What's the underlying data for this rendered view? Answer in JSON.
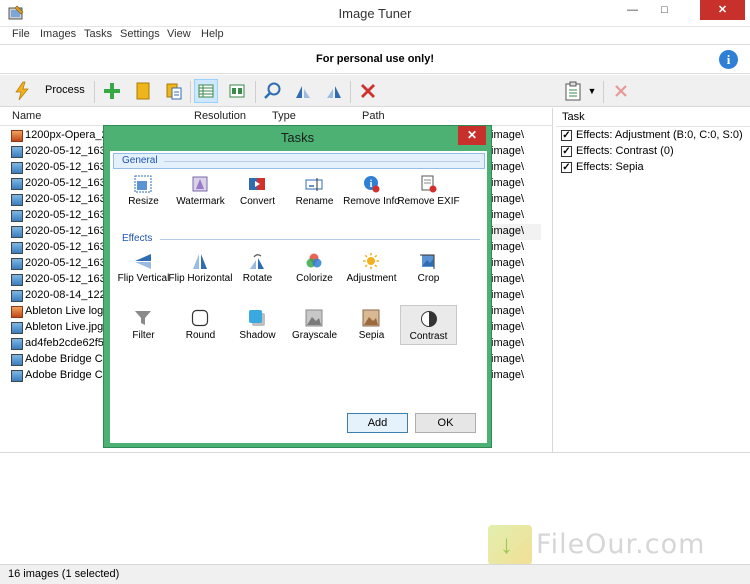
{
  "window": {
    "title": "Image Tuner",
    "min_glyph": "—",
    "max_glyph": "□",
    "close_glyph": "✕"
  },
  "menu": [
    "File",
    "Images",
    "Tasks",
    "Settings",
    "View",
    "Help"
  ],
  "notice": {
    "text": "For personal use only!",
    "info_glyph": "i"
  },
  "toolbar": {
    "process_label": "Process"
  },
  "columns": {
    "name": "Name",
    "resolution": "Resolution",
    "type": "Type",
    "path": "Path"
  },
  "files": [
    {
      "name": "1200px-Opera_2015",
      "icon": "orange-image-icon"
    },
    {
      "name": "2020-05-12_163545",
      "icon": "image-icon"
    },
    {
      "name": "2020-05-12_163630",
      "icon": "image-icon"
    },
    {
      "name": "2020-05-12_163700",
      "icon": "image-icon"
    },
    {
      "name": "2020-05-12_163720",
      "icon": "image-icon"
    },
    {
      "name": "2020-05-12_163740",
      "icon": "image-icon"
    },
    {
      "name": "2020-05-12_163810",
      "icon": "image-icon"
    },
    {
      "name": "2020-05-12_163830",
      "icon": "image-icon"
    },
    {
      "name": "2020-05-12_163850",
      "icon": "image-icon"
    },
    {
      "name": "2020-05-12_163910",
      "icon": "image-icon"
    },
    {
      "name": "2020-08-14_122520",
      "icon": "image-icon"
    },
    {
      "name": "Ableton Live logo",
      "icon": "orange-image-icon"
    },
    {
      "name": "Ableton Live.jpg",
      "icon": "image-icon"
    },
    {
      "name": "ad4feb2cde62f54f",
      "icon": "image-icon"
    },
    {
      "name": "Adobe Bridge CC",
      "icon": "image-icon"
    },
    {
      "name": "Adobe Bridge CC",
      "icon": "image-icon"
    }
  ],
  "path_values": [
    "image\\",
    "image\\",
    "image\\",
    "image\\",
    "image\\",
    "image\\",
    "image\\",
    "image\\",
    "image\\",
    "image\\",
    "image\\",
    "image\\",
    "image\\",
    "image\\",
    "image\\",
    "image\\"
  ],
  "task_panel": {
    "header": "Task",
    "items": [
      {
        "label": "Effects: Adjustment (B:0, C:0, S:0)",
        "checked": true
      },
      {
        "label": "Effects: Contrast (0)",
        "checked": true
      },
      {
        "label": "Effects: Sepia",
        "checked": true
      }
    ]
  },
  "dialog": {
    "title": "Tasks",
    "close_glyph": "✕",
    "general_label": "General",
    "effects_label": "Effects",
    "general_tiles": [
      {
        "label": "Resize",
        "icon": "resize-icon"
      },
      {
        "label": "Watermark",
        "icon": "watermark-icon"
      },
      {
        "label": "Convert",
        "icon": "convert-icon"
      },
      {
        "label": "Rename",
        "icon": "rename-icon"
      },
      {
        "label": "Remove Info",
        "icon": "remove-info-icon"
      },
      {
        "label": "Remove EXIF",
        "icon": "remove-exif-icon"
      }
    ],
    "effects_tiles_row1": [
      {
        "label": "Flip Vertical",
        "icon": "flip-vertical-icon"
      },
      {
        "label": "Flip Horizontal",
        "icon": "flip-horizontal-icon"
      },
      {
        "label": "Rotate",
        "icon": "rotate-icon"
      },
      {
        "label": "Colorize",
        "icon": "colorize-icon"
      },
      {
        "label": "Adjustment",
        "icon": "adjustment-icon"
      },
      {
        "label": "Crop",
        "icon": "crop-icon"
      }
    ],
    "effects_tiles_row2": [
      {
        "label": "Filter",
        "icon": "filter-icon"
      },
      {
        "label": "Round",
        "icon": "round-icon"
      },
      {
        "label": "Shadow",
        "icon": "shadow-icon"
      },
      {
        "label": "Grayscale",
        "icon": "grayscale-icon"
      },
      {
        "label": "Sepia",
        "icon": "sepia-icon"
      },
      {
        "label": "Contrast",
        "icon": "contrast-icon",
        "selected": true
      }
    ],
    "add_label": "Add",
    "ok_label": "OK"
  },
  "status": {
    "text": "16 images (1 selected)"
  },
  "watermark": {
    "text": "FileOur.com"
  },
  "colors": {
    "dialog_frame": "#4cb172",
    "close_red": "#c7302b",
    "accent_blue": "#2f7fd6",
    "section_blue": "#1d55b4"
  }
}
